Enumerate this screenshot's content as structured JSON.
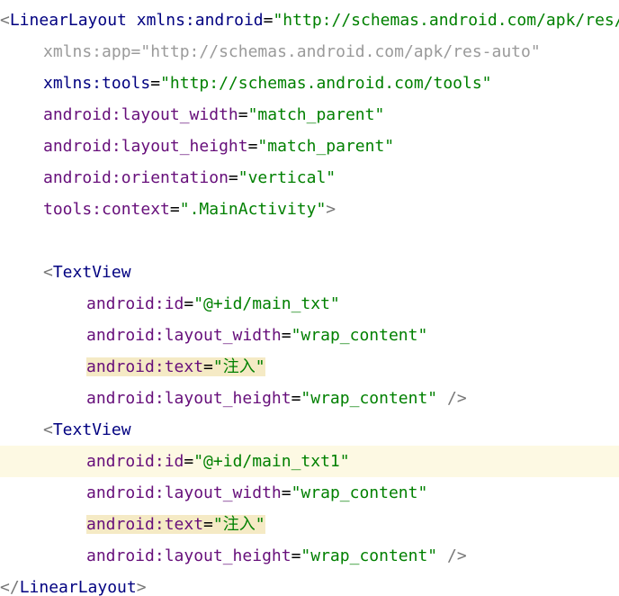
{
  "editor": {
    "language": "XML",
    "lines": [
      {
        "indent": 0,
        "parts": [
          [
            "bracket",
            "<"
          ],
          [
            "tag",
            "LinearLayout"
          ],
          [
            "sp",
            " "
          ],
          [
            "xmlns",
            "xmlns:android"
          ],
          [
            "eq",
            "="
          ],
          [
            "val",
            "\"http://schemas.android.com/apk/res/android\""
          ]
        ]
      },
      {
        "indent": 1,
        "parts": [
          [
            "dim",
            "xmlns:app=\"http://schemas.android.com/apk/res-auto\""
          ]
        ]
      },
      {
        "indent": 1,
        "parts": [
          [
            "xmlns",
            "xmlns:tools"
          ],
          [
            "eq",
            "="
          ],
          [
            "val",
            "\"http://schemas.android.com/tools\""
          ]
        ]
      },
      {
        "indent": 1,
        "parts": [
          [
            "attr",
            "android:layout_width"
          ],
          [
            "eq",
            "="
          ],
          [
            "val",
            "\"match_parent\""
          ]
        ]
      },
      {
        "indent": 1,
        "parts": [
          [
            "attr",
            "android:layout_height"
          ],
          [
            "eq",
            "="
          ],
          [
            "val",
            "\"match_parent\""
          ]
        ]
      },
      {
        "indent": 1,
        "parts": [
          [
            "attr",
            "android:orientation"
          ],
          [
            "eq",
            "="
          ],
          [
            "val",
            "\"vertical\""
          ]
        ]
      },
      {
        "indent": 1,
        "parts": [
          [
            "attr",
            "tools:context"
          ],
          [
            "eq",
            "="
          ],
          [
            "val",
            "\".MainActivity\""
          ],
          [
            "bracket",
            ">"
          ]
        ]
      },
      {
        "indent": 0,
        "parts": []
      },
      {
        "indent": 1,
        "parts": [
          [
            "bracket",
            "<"
          ],
          [
            "tag",
            "TextView"
          ]
        ]
      },
      {
        "indent": 2,
        "parts": [
          [
            "attr",
            "android:id"
          ],
          [
            "eq",
            "="
          ],
          [
            "val",
            "\"@+id/main_txt\""
          ]
        ]
      },
      {
        "indent": 2,
        "parts": [
          [
            "attr",
            "android:layout_width"
          ],
          [
            "eq",
            "="
          ],
          [
            "val",
            "\"wrap_content\""
          ]
        ]
      },
      {
        "indent": 2,
        "highlight": true,
        "parts": [
          [
            "attr",
            "android:text"
          ],
          [
            "eq",
            "="
          ],
          [
            "val",
            "\"注入\""
          ]
        ]
      },
      {
        "indent": 2,
        "parts": [
          [
            "attr",
            "android:layout_height"
          ],
          [
            "eq",
            "="
          ],
          [
            "val",
            "\"wrap_content\""
          ],
          [
            "sp",
            " "
          ],
          [
            "bracket",
            "/>"
          ]
        ]
      },
      {
        "indent": 1,
        "parts": [
          [
            "bracket",
            "<"
          ],
          [
            "tag",
            "TextView"
          ]
        ]
      },
      {
        "indent": 2,
        "current": true,
        "parts": [
          [
            "attr",
            "android:id"
          ],
          [
            "eq",
            "="
          ],
          [
            "val",
            "\"@+id/main_txt1\""
          ]
        ]
      },
      {
        "indent": 2,
        "parts": [
          [
            "attr",
            "android:layout_width"
          ],
          [
            "eq",
            "="
          ],
          [
            "val",
            "\"wrap_content\""
          ]
        ]
      },
      {
        "indent": 2,
        "highlight": true,
        "parts": [
          [
            "attr",
            "android:text"
          ],
          [
            "eq",
            "="
          ],
          [
            "val",
            "\"注入\""
          ]
        ]
      },
      {
        "indent": 2,
        "parts": [
          [
            "attr",
            "android:layout_height"
          ],
          [
            "eq",
            "="
          ],
          [
            "val",
            "\"wrap_content\""
          ],
          [
            "sp",
            " "
          ],
          [
            "bracket",
            "/>"
          ]
        ]
      },
      {
        "indent": 0,
        "parts": [
          [
            "bracket",
            "</"
          ],
          [
            "tag",
            "LinearLayout"
          ],
          [
            "bracket",
            ">"
          ]
        ]
      }
    ]
  }
}
